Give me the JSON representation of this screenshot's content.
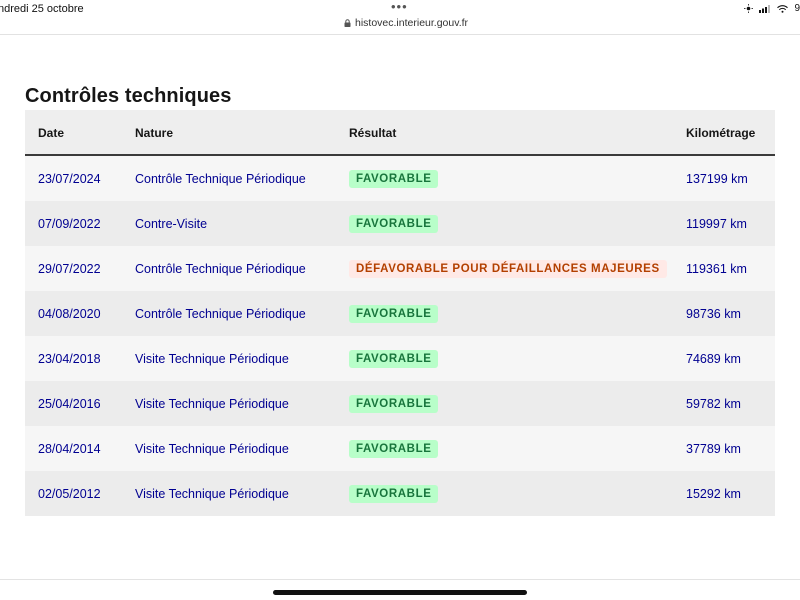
{
  "status_bar": {
    "date": "ndredi 25 octobre",
    "dots": "•••",
    "url": "histovec.interieur.gouv.fr",
    "battery_partial": "9"
  },
  "page": {
    "title": "Contrôles techniques"
  },
  "table": {
    "headers": {
      "date": "Date",
      "nature": "Nature",
      "result": "Résultat",
      "km": "Kilométrage"
    },
    "rows": [
      {
        "date": "23/07/2024",
        "nature": "Contrôle Technique Périodique",
        "result": "FAVORABLE",
        "status": "ok",
        "km": "137199 km"
      },
      {
        "date": "07/09/2022",
        "nature": "Contre-Visite",
        "result": "FAVORABLE",
        "status": "ok",
        "km": "119997 km"
      },
      {
        "date": "29/07/2022",
        "nature": "Contrôle Technique Périodique",
        "result": "DÉFAVORABLE POUR DÉFAILLANCES MAJEURES",
        "status": "ko",
        "km": "119361 km"
      },
      {
        "date": "04/08/2020",
        "nature": "Contrôle Technique Périodique",
        "result": "FAVORABLE",
        "status": "ok",
        "km": "98736 km"
      },
      {
        "date": "23/04/2018",
        "nature": "Visite Technique Périodique",
        "result": "FAVORABLE",
        "status": "ok",
        "km": "74689 km"
      },
      {
        "date": "25/04/2016",
        "nature": "Visite Technique Périodique",
        "result": "FAVORABLE",
        "status": "ok",
        "km": "59782 km"
      },
      {
        "date": "28/04/2014",
        "nature": "Visite Technique Périodique",
        "result": "FAVORABLE",
        "status": "ok",
        "km": "37789 km"
      },
      {
        "date": "02/05/2012",
        "nature": "Visite Technique Périodique",
        "result": "FAVORABLE",
        "status": "ok",
        "km": "15292 km"
      }
    ]
  },
  "colors": {
    "link_blue": "#000091",
    "ok_bg": "#b8fec9",
    "ok_text": "#18753c",
    "ko_bg": "#ffe9e6",
    "ko_text": "#b34000"
  }
}
